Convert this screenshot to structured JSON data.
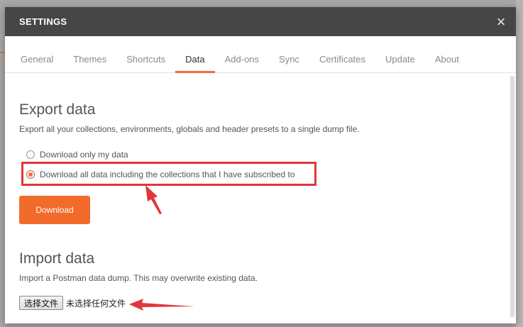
{
  "modal": {
    "title": "SETTINGS",
    "close_glyph": "×"
  },
  "tabs": [
    {
      "label": "General",
      "active": false
    },
    {
      "label": "Themes",
      "active": false
    },
    {
      "label": "Shortcuts",
      "active": false
    },
    {
      "label": "Data",
      "active": true
    },
    {
      "label": "Add-ons",
      "active": false
    },
    {
      "label": "Sync",
      "active": false
    },
    {
      "label": "Certificates",
      "active": false
    },
    {
      "label": "Update",
      "active": false
    },
    {
      "label": "About",
      "active": false
    }
  ],
  "export": {
    "title": "Export data",
    "description": "Export all your collections, environments, globals and header presets to a single dump file.",
    "options": [
      {
        "label": "Download only my data",
        "selected": false
      },
      {
        "label": "Download all data including the collections that I have subscribed to",
        "selected": true
      }
    ],
    "download_label": "Download"
  },
  "import": {
    "title": "Import data",
    "description": "Import a Postman data dump. This may overwrite existing data.",
    "choose_file_label": "选择文件",
    "no_file_text": "未选择任何文件"
  },
  "colors": {
    "accent": "#f26b3a",
    "header_bg": "#464646",
    "annotation_red": "#e1363a"
  }
}
